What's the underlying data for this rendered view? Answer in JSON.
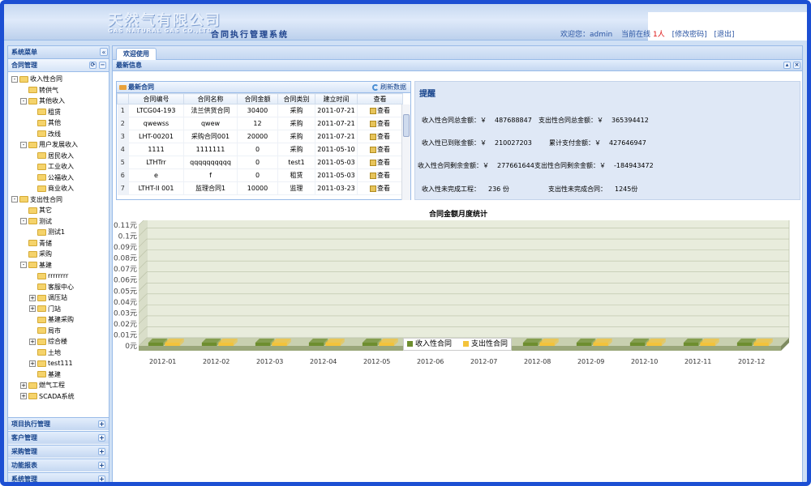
{
  "header": {
    "company_name": "天然气有限公司",
    "company_en": "GAS NATURAL GAS CO.,LTD",
    "system_name": "合同执行管理系统",
    "welcome": "欢迎您：admin",
    "online_label": "当前在线",
    "online_count": "1人",
    "change_password": "[修改密码]",
    "logout": "[退出]"
  },
  "sidebar": {
    "title": "系统菜单",
    "section": "合同管理",
    "tree": [
      {
        "label": "收入性合同",
        "level": 0,
        "toggle": "-"
      },
      {
        "label": "转供气",
        "level": 1,
        "toggle": ""
      },
      {
        "label": "其他收入",
        "level": 1,
        "toggle": "-"
      },
      {
        "label": "租赁",
        "level": 2,
        "toggle": ""
      },
      {
        "label": "其他",
        "level": 2,
        "toggle": ""
      },
      {
        "label": "改线",
        "level": 2,
        "toggle": ""
      },
      {
        "label": "用户发展收入",
        "level": 1,
        "toggle": "-"
      },
      {
        "label": "居民收入",
        "level": 2,
        "toggle": ""
      },
      {
        "label": "工业收入",
        "level": 2,
        "toggle": ""
      },
      {
        "label": "公福收入",
        "level": 2,
        "toggle": ""
      },
      {
        "label": "商业收入",
        "level": 2,
        "toggle": ""
      },
      {
        "label": "支出性合同",
        "level": 0,
        "toggle": "-"
      },
      {
        "label": "其它",
        "level": 1,
        "toggle": ""
      },
      {
        "label": "测试",
        "level": 1,
        "toggle": "-"
      },
      {
        "label": "测试1",
        "level": 2,
        "toggle": ""
      },
      {
        "label": "青储",
        "level": 1,
        "toggle": ""
      },
      {
        "label": "采购",
        "level": 1,
        "toggle": ""
      },
      {
        "label": "基建",
        "level": 1,
        "toggle": "-"
      },
      {
        "label": "rrrrrrrr",
        "level": 2,
        "toggle": ""
      },
      {
        "label": "客服中心",
        "level": 2,
        "toggle": ""
      },
      {
        "label": "调压站",
        "level": 2,
        "toggle": "+"
      },
      {
        "label": "门站",
        "level": 2,
        "toggle": "+"
      },
      {
        "label": "基建采购",
        "level": 2,
        "toggle": ""
      },
      {
        "label": "局市",
        "level": 2,
        "toggle": ""
      },
      {
        "label": "综合楼",
        "level": 2,
        "toggle": "+"
      },
      {
        "label": "土地",
        "level": 2,
        "toggle": ""
      },
      {
        "label": "test111",
        "level": 2,
        "toggle": "+"
      },
      {
        "label": "基建",
        "level": 2,
        "toggle": ""
      },
      {
        "label": "燃气工程",
        "level": 1,
        "toggle": "+"
      },
      {
        "label": "SCADA系统",
        "level": 1,
        "toggle": "+"
      }
    ],
    "accordion": [
      "项目执行管理",
      "客户管理",
      "采购管理",
      "功能报表",
      "系统管理"
    ]
  },
  "main": {
    "tab": "欢迎使用",
    "subtitle": "最新信息",
    "contracts": {
      "title": "最新合同",
      "refresh": "刷新数据",
      "columns": [
        "合同编号",
        "合同名称",
        "合同金额",
        "合同类别",
        "建立时间",
        "查看"
      ],
      "rows": [
        [
          "1",
          "LTCG04-193",
          "法兰供货合同",
          "30400",
          "采购",
          "2011-07-21",
          "查看"
        ],
        [
          "2",
          "qwewss",
          "qwew",
          "12",
          "采购",
          "2011-07-21",
          "查看"
        ],
        [
          "3",
          "LHT-00201",
          "采购合同001",
          "20000",
          "采购",
          "2011-07-21",
          "查看"
        ],
        [
          "4",
          "1111",
          "1111111",
          "0",
          "采购",
          "2011-05-10",
          "查看"
        ],
        [
          "5",
          "LTHTrr",
          "qqqqqqqqqq",
          "0",
          "test1",
          "2011-05-03",
          "查看"
        ],
        [
          "6",
          "e",
          "f",
          "0",
          "租赁",
          "2011-05-03",
          "查看"
        ],
        [
          "7",
          "LTHT-II 001",
          "监理合同1",
          "10000",
          "监理",
          "2011-03-23",
          "查看"
        ]
      ]
    },
    "reminder": {
      "title": "提醒",
      "items": [
        {
          "label": "收入性合同总金额：￥",
          "value": "487688847"
        },
        {
          "label": "支出性合同总金额：￥",
          "value": "365394412"
        },
        {
          "label": "收入性已到账金额：￥",
          "value": "210027203"
        },
        {
          "label": "累计支付金额：￥",
          "value": "427646947"
        },
        {
          "label": "收入性合同剩余金额：￥",
          "value": "277661644"
        },
        {
          "label": "支出性合同剩余金额：￥",
          "value": "-184943472"
        },
        {
          "label": "收入性未完成工程：",
          "value": "236 份"
        },
        {
          "label": "支出性未完成合同：",
          "value": "1245份"
        }
      ]
    }
  },
  "chart_data": {
    "type": "bar",
    "title": "合同金额月度统计",
    "categories": [
      "2012-01",
      "2012-02",
      "2012-03",
      "2012-04",
      "2012-05",
      "2012-06",
      "2012-07",
      "2012-08",
      "2012-09",
      "2012-10",
      "2012-11",
      "2012-12"
    ],
    "series": [
      {
        "name": "收入性合同",
        "values": [
          0,
          0,
          0,
          0,
          0,
          0,
          0,
          0,
          0,
          0,
          0,
          0
        ],
        "color": "#6e8e2f"
      },
      {
        "name": "支出性合同",
        "values": [
          0,
          0,
          0,
          0,
          0,
          0,
          0,
          0,
          0,
          0,
          0,
          0
        ],
        "color": "#f3c33b"
      }
    ],
    "yticks": [
      "0元",
      "0.01元",
      "0.02元",
      "0.03元",
      "0.04元",
      "0.05元",
      "0.06元",
      "0.07元",
      "0.08元",
      "0.09元",
      "0.1元",
      "0.11元"
    ],
    "ylim": [
      0,
      0.11
    ],
    "grid": true,
    "legend": "bottom"
  }
}
